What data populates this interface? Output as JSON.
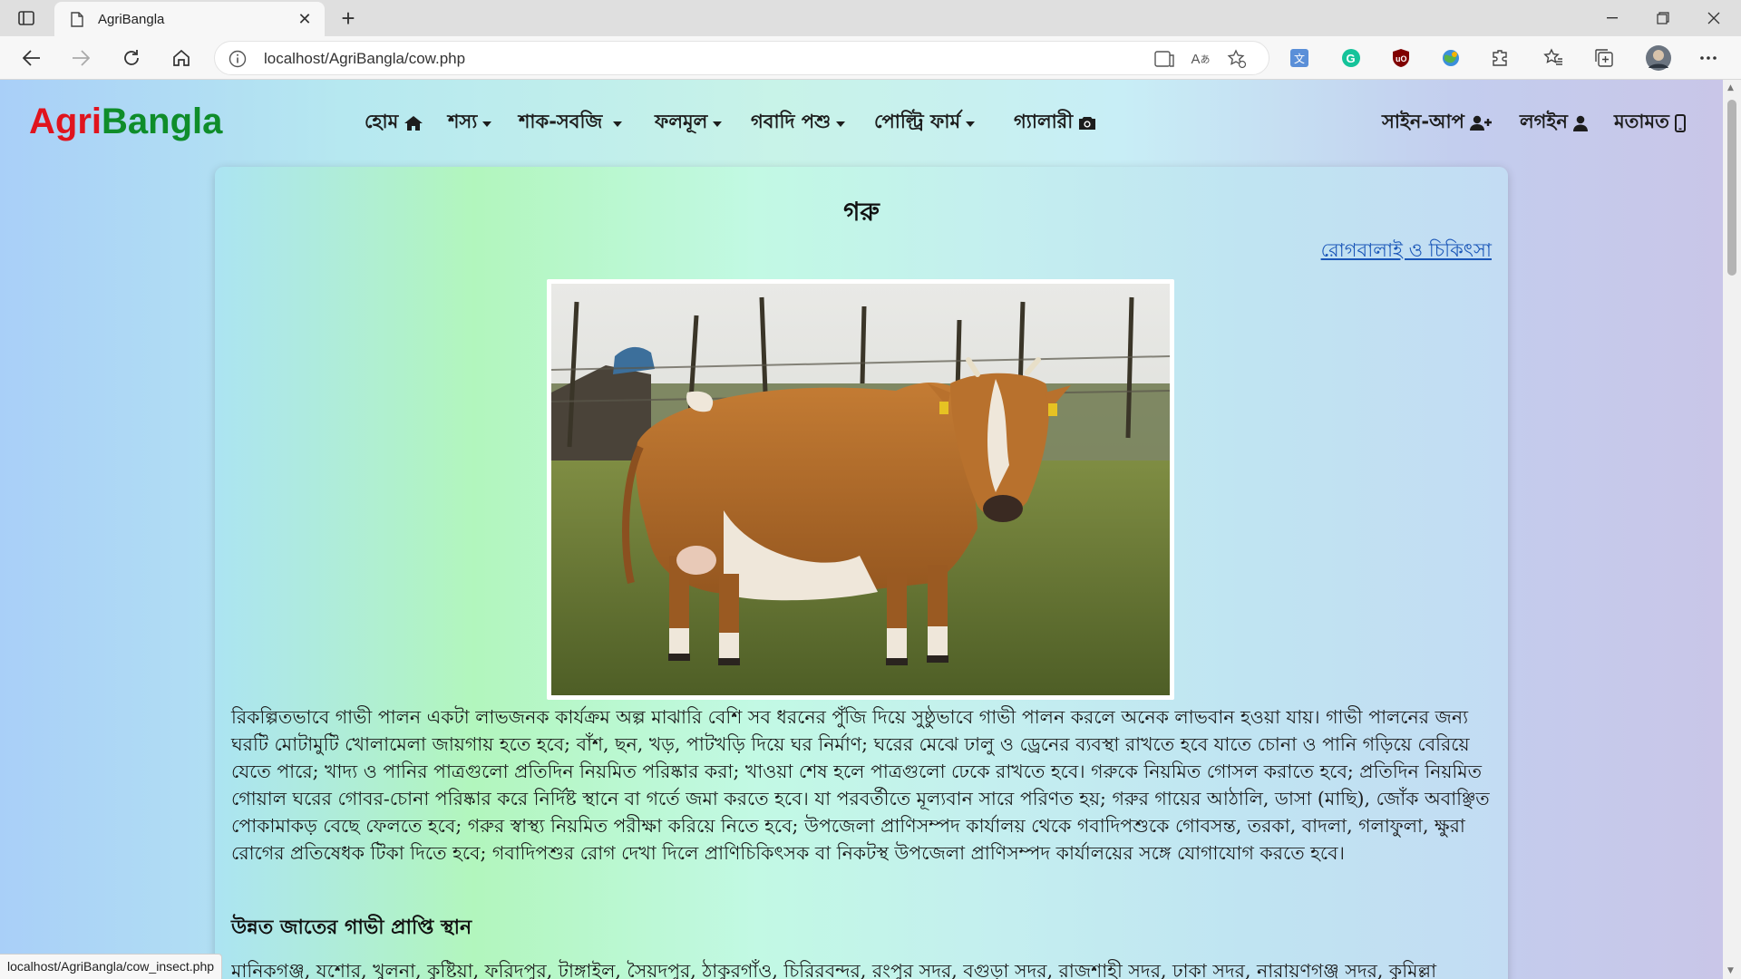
{
  "browser": {
    "tab_title": "AgriBangla",
    "url": "localhost/AgriBangla/cow.php",
    "status_url": "localhost/AgriBangla/cow_insect.php",
    "new_tab_label": "+",
    "close_tab_label": "✕"
  },
  "site": {
    "brand_agri": "Agri",
    "brand_bangla": "Bangla",
    "colors": {
      "brand_red": "#e0141e",
      "brand_green": "#0f8d2a",
      "link_blue": "#1a56b8"
    }
  },
  "nav": {
    "home": "হোম",
    "crops": "শস্য",
    "vegetables": "শাক-সবজি",
    "fruits": "ফলমূল",
    "livestock": "গবাদি পশু",
    "poultry": "পোল্ট্রি ফার্ম",
    "gallery": "গ্যালারী",
    "signup": "সাইন-আপ",
    "login": "লগইন",
    "feedback": "মতামত"
  },
  "content": {
    "title": "গরু",
    "disease_link": "রোগবালাই ও চিকিৎসা",
    "paragraph": "রিকল্পিতভাবে গাভী পালন একটা লাভজনক কার্যক্রম অল্প মাঝারি বেশি সব ধরনের পুঁজি দিয়ে সুষ্ঠুভাবে গাভী পালন করলে অনেক লাভবান হওয়া যায়। গাভী পালনের জন্য ঘরটি মোটামুটি খোলামেলা জায়গায় হতে হবে; বাঁশ, ছন, খড়, পাটখড়ি দিয়ে ঘর নির্মাণ; ঘরের মেঝে ঢালু ও ড্রেনের ব্যবস্থা রাখতে হবে যাতে চোনা ও পানি গড়িয়ে বেরিয়ে যেতে পারে; খাদ্য ও পানির পাত্রগুলো প্রতিদিন নিয়মিত পরিষ্কার করা; খাওয়া শেষ হলে পাত্রগুলো ঢেকে রাখতে হবে। গরুকে নিয়মিত গোসল করাতে হবে; প্রতিদিন নিয়মিত গোয়াল ঘরের গোবর-চোনা পরিষ্কার করে নির্দিষ্ট স্থানে বা গর্তে জমা করতে হবে। যা পরবর্তীতে মূল্যবান সারে পরিণত হয়; গরুর গায়ের আঠালি, ডাসা (মাছি), জোঁক অবাঞ্ছিত পোকামাকড় বেছে ফেলতে হবে; গরুর স্বাস্থ্য নিয়মিত পরীক্ষা করিয়ে নিতে হবে; উপজেলা প্রাণিসম্পদ কার্যালয় থেকে গবাদিপশুকে গোবসন্ত, তরকা, বাদলা, গলাফুলা, ক্ষুরা রোগের প্রতিষেধক টিকা দিতে হবে; গবাদিপশুর রোগ দেখা দিলে প্রাণিচিকিৎসক বা নিকটস্থ উপজেলা প্রাণিসম্পদ কার্যালয়ের সঙ্গে যোগাযোগ করতে হবে।",
    "subheading": "উন্নত জাতের গাভী প্রাপ্তি স্থান",
    "paragraph2": "মানিকগঞ্জ, যশোর, খুলনা, কুষ্টিয়া, ফরিদপুর, টাঙ্গাইল, সৈয়দপুর, ঠাকুরগাঁও, চিরিরবন্দর, রংপুর সদর, বগুড়া সদর, রাজশাহী সদর, ঢাকা সদর, নারায়ণগঞ্জ সদর, কুমিল্লা"
  }
}
